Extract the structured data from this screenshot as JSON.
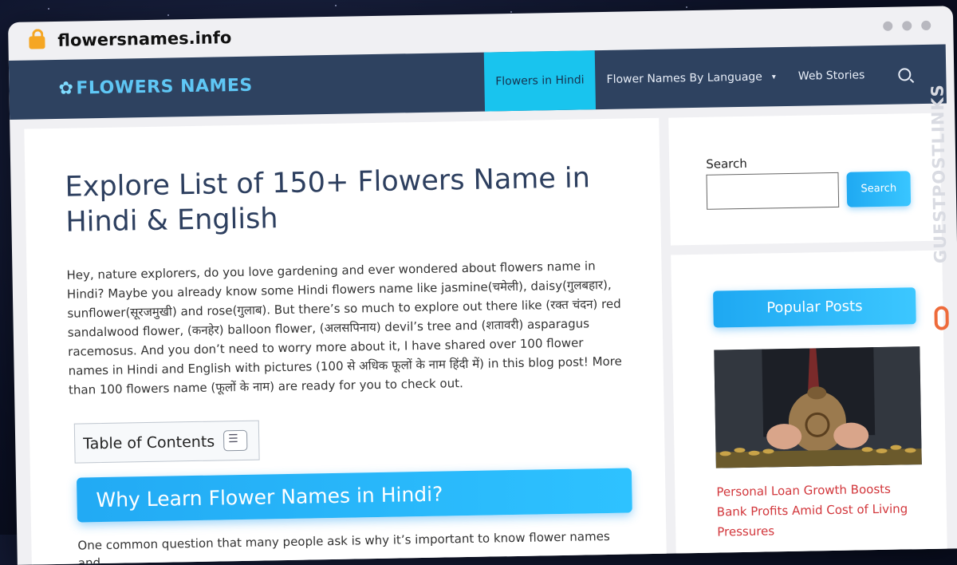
{
  "browser": {
    "url": "flowersnames.info"
  },
  "site": {
    "logo_text": "FLOWERS NAMES",
    "menu": [
      {
        "label": "Flowers in Hindi"
      },
      {
        "label": "Flower Names By Language"
      },
      {
        "label": "Web Stories"
      }
    ]
  },
  "article": {
    "title": "Explore List of 150+ Flowers Name in Hindi & English",
    "intro": "Hey, nature explorers, do you love gardening and ever wondered about flowers name in Hindi? Maybe you already know some Hindi flowers name like jasmine(चमेली), daisy(गुलबहार), sunflower(सूरजमुखी) and rose(गुलाब). But there’s so much to explore out there like (रक्त चंदन) red sandalwood flower, (कनहेर) balloon flower, (अलसपिनाय) devil’s tree and (शतावरी) asparagus racemosus. And you don’t need to worry more about it, I have shared over 100 flower names in Hindi and English with pictures (100 से अधिक फूलों के नाम हिंदी में) in this blog post! More than 100 flowers name (फूलों के नाम) are ready for you to check out.",
    "toc_label": "Table of Contents",
    "section_heading": "Why Learn Flower Names in Hindi?",
    "section_para": "One common question that many people ask is why it’s important to know flower names and"
  },
  "sidebar": {
    "search_label": "Search",
    "search_button": "Search",
    "popular_heading": "Popular Posts",
    "post_title": "Personal Loan Growth Boosts Bank Profits Amid Cost of Living Pressures"
  },
  "watermark": {
    "text": "GUESTPOSTLINKS"
  },
  "colors": {
    "nav_bg": "#2e4260",
    "accent": "#19c4ee",
    "button": "#22aaf4",
    "post_link": "#d2363b"
  }
}
